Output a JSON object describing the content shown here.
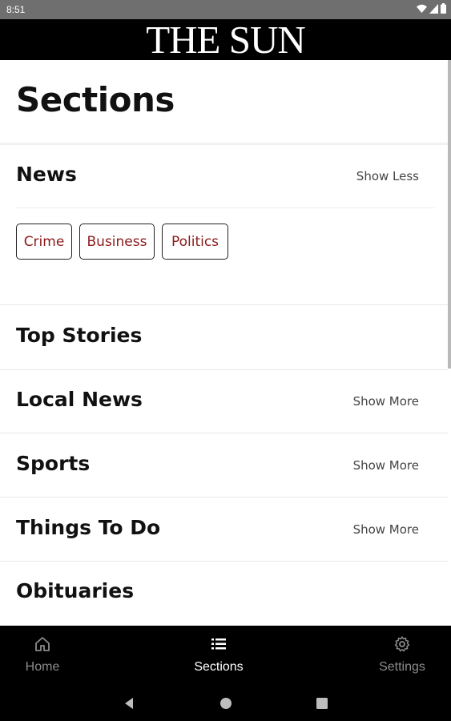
{
  "status_bar": {
    "time": "8:51",
    "icons": [
      "wifi-icon",
      "signal-icon",
      "battery-icon"
    ]
  },
  "masthead": {
    "logo": "THE SUN"
  },
  "page": {
    "title": "Sections"
  },
  "sections": [
    {
      "name": "News",
      "toggle": "Show Less",
      "expanded": true,
      "subsections": [
        "Crime",
        "Business",
        "Politics"
      ]
    },
    {
      "name": "Top Stories",
      "toggle": ""
    },
    {
      "name": "Local News",
      "toggle": "Show More"
    },
    {
      "name": "Sports",
      "toggle": "Show More"
    },
    {
      "name": "Things To Do",
      "toggle": "Show More"
    },
    {
      "name": "Obituaries",
      "toggle": ""
    }
  ],
  "bottom_nav": {
    "items": [
      {
        "label": "Home",
        "icon": "home-icon",
        "active": false
      },
      {
        "label": "Sections",
        "icon": "list-icon",
        "active": true
      },
      {
        "label": "Settings",
        "icon": "gear-icon",
        "active": false
      }
    ]
  },
  "system_nav": [
    "back-icon",
    "home-circle-icon",
    "recents-icon"
  ],
  "colors": {
    "accent": "#8b1a1a",
    "masthead_bg": "#000000",
    "status_bar_bg": "#6f6f6f"
  }
}
